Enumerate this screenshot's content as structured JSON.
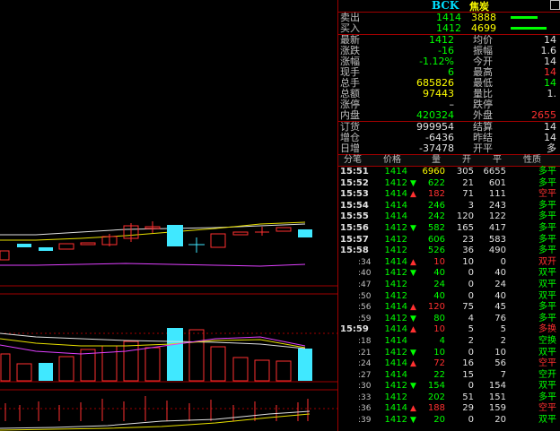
{
  "header": {
    "code": "BCK",
    "name": "焦炭"
  },
  "quote": {
    "sell": {
      "label": "卖出",
      "price": "1414",
      "volume": "3888"
    },
    "buy": {
      "label": "买入",
      "price": "1412",
      "volume": "4699"
    },
    "rows": [
      {
        "l1": "最新",
        "v1": "1412",
        "c1": "green",
        "l2": "均价",
        "v2": "14",
        "c2": "white"
      },
      {
        "l1": "涨跌",
        "v1": "-16",
        "c1": "green",
        "l2": "振幅",
        "v2": "1.6",
        "c2": "white"
      },
      {
        "l1": "涨幅",
        "v1": "-1.12%",
        "c1": "green",
        "l2": "今开",
        "v2": "14",
        "c2": "white"
      },
      {
        "l1": "现手",
        "v1": "6",
        "c1": "green",
        "l2": "最高",
        "v2": "14",
        "c2": "red"
      },
      {
        "l1": "总手",
        "v1": "685826",
        "c1": "yellow",
        "l2": "最低",
        "v2": "14",
        "c2": "green"
      },
      {
        "l1": "总额",
        "v1": "97443",
        "c1": "yellow",
        "l2": "量比",
        "v2": "1.",
        "c2": "white"
      },
      {
        "l1": "涨停",
        "v1": "–",
        "c1": "white",
        "l2": "跌停",
        "v2": "",
        "c2": "white"
      },
      {
        "l1": "内盘",
        "v1": "420324",
        "c1": "green",
        "l2": "外盘",
        "v2": "2655",
        "c2": "red"
      },
      {
        "l1": "订货",
        "v1": "999954",
        "c1": "white",
        "l2": "结算",
        "v2": "14",
        "c2": "white"
      },
      {
        "l1": "增仓",
        "v1": "-6436",
        "c1": "white",
        "l2": "昨结",
        "v2": "14",
        "c2": "white"
      },
      {
        "l1": "日增",
        "v1": "-37478",
        "c1": "white",
        "l2": "开平",
        "v2": "多",
        "c2": "white"
      }
    ]
  },
  "ticks_header": [
    "分笔",
    "价格",
    "量",
    "开",
    "平",
    "性质"
  ],
  "ticks": [
    {
      "t": "15:51",
      "full": true,
      "p": "1414",
      "a": "",
      "v": "6960",
      "vc": "yellow",
      "o": "305",
      "c": "6655",
      "n": "多平",
      "nc": "green"
    },
    {
      "t": "15:52",
      "full": true,
      "p": "1412",
      "a": "down",
      "v": "622",
      "vc": "green",
      "o": "21",
      "c": "601",
      "n": "多平",
      "nc": "green"
    },
    {
      "t": "15:53",
      "full": true,
      "p": "1414",
      "a": "up",
      "v": "182",
      "vc": "red",
      "o": "71",
      "c": "111",
      "n": "空平",
      "nc": "red"
    },
    {
      "t": "15:54",
      "full": true,
      "p": "1414",
      "a": "",
      "v": "246",
      "vc": "green",
      "o": "3",
      "c": "243",
      "n": "多平",
      "nc": "green"
    },
    {
      "t": "15:55",
      "full": true,
      "p": "1414",
      "a": "",
      "v": "242",
      "vc": "green",
      "o": "120",
      "c": "122",
      "n": "多平",
      "nc": "green"
    },
    {
      "t": "15:56",
      "full": true,
      "p": "1412",
      "a": "down",
      "v": "582",
      "vc": "green",
      "o": "165",
      "c": "417",
      "n": "多平",
      "nc": "green"
    },
    {
      "t": "15:57",
      "full": true,
      "p": "1412",
      "a": "",
      "v": "606",
      "vc": "green",
      "o": "23",
      "c": "583",
      "n": "多平",
      "nc": "green"
    },
    {
      "t": "15:58",
      "full": true,
      "p": "1412",
      "a": "",
      "v": "526",
      "vc": "green",
      "o": "36",
      "c": "490",
      "n": "多平",
      "nc": "green"
    },
    {
      "t": ":34",
      "full": false,
      "p": "1414",
      "a": "up",
      "v": "10",
      "vc": "red",
      "o": "10",
      "c": "0",
      "n": "双开",
      "nc": "red"
    },
    {
      "t": ":40",
      "full": false,
      "p": "1412",
      "a": "down",
      "v": "40",
      "vc": "green",
      "o": "0",
      "c": "40",
      "n": "双平",
      "nc": "green"
    },
    {
      "t": ":47",
      "full": false,
      "p": "1412",
      "a": "",
      "v": "24",
      "vc": "green",
      "o": "0",
      "c": "24",
      "n": "双平",
      "nc": "green"
    },
    {
      "t": ":50",
      "full": false,
      "p": "1412",
      "a": "",
      "v": "40",
      "vc": "green",
      "o": "0",
      "c": "40",
      "n": "双平",
      "nc": "green"
    },
    {
      "t": ":56",
      "full": false,
      "p": "1414",
      "a": "up",
      "v": "120",
      "vc": "red",
      "o": "75",
      "c": "45",
      "n": "多平",
      "nc": "green"
    },
    {
      "t": ":59",
      "full": false,
      "p": "1412",
      "a": "down",
      "v": "80",
      "vc": "green",
      "o": "4",
      "c": "76",
      "n": "多平",
      "nc": "green"
    },
    {
      "t": "15:59",
      "full": true,
      "p": "1414",
      "a": "up",
      "v": "10",
      "vc": "red",
      "o": "5",
      "c": "5",
      "n": "多换",
      "nc": "red"
    },
    {
      "t": ":18",
      "full": false,
      "p": "1414",
      "a": "",
      "v": "4",
      "vc": "green",
      "o": "2",
      "c": "2",
      "n": "空换",
      "nc": "green"
    },
    {
      "t": ":21",
      "full": false,
      "p": "1412",
      "a": "down",
      "v": "10",
      "vc": "green",
      "o": "0",
      "c": "10",
      "n": "双平",
      "nc": "green"
    },
    {
      "t": ":24",
      "full": false,
      "p": "1414",
      "a": "up",
      "v": "72",
      "vc": "red",
      "o": "16",
      "c": "56",
      "n": "空平",
      "nc": "red"
    },
    {
      "t": ":27",
      "full": false,
      "p": "1414",
      "a": "",
      "v": "22",
      "vc": "green",
      "o": "15",
      "c": "7",
      "n": "空开",
      "nc": "green"
    },
    {
      "t": ":30",
      "full": false,
      "p": "1412",
      "a": "down",
      "v": "154",
      "vc": "green",
      "o": "0",
      "c": "154",
      "n": "双平",
      "nc": "green"
    },
    {
      "t": ":33",
      "full": false,
      "p": "1412",
      "a": "",
      "v": "202",
      "vc": "green",
      "o": "51",
      "c": "151",
      "n": "多平",
      "nc": "green"
    },
    {
      "t": ":36",
      "full": false,
      "p": "1414",
      "a": "up",
      "v": "188",
      "vc": "red",
      "o": "29",
      "c": "159",
      "n": "空平",
      "nc": "red"
    },
    {
      "t": ":39",
      "full": false,
      "p": "1412",
      "a": "down",
      "v": "20",
      "vc": "green",
      "o": "0",
      "c": "20",
      "n": "双平",
      "nc": "green"
    }
  ],
  "colors": {
    "up": "#ff3030",
    "down": "#00ff00",
    "grid": "#a00000",
    "cyan": "#40e8ff"
  }
}
